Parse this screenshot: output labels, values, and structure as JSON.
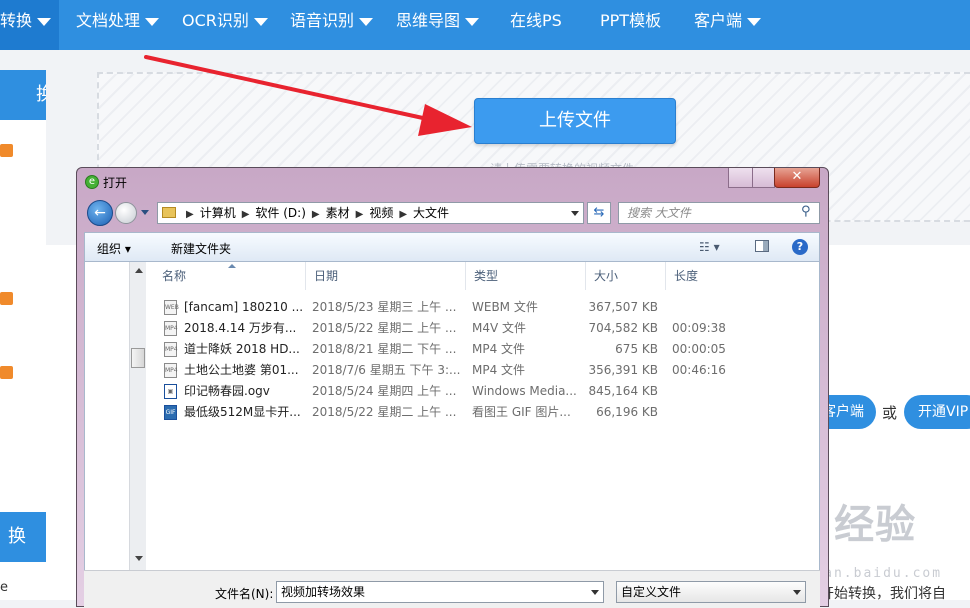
{
  "topnav": {
    "items": [
      {
        "label": "转换"
      },
      {
        "label": "文档处理"
      },
      {
        "label": "OCR识别"
      },
      {
        "label": "语音识别"
      },
      {
        "label": "思维导图"
      },
      {
        "label": "在线PS"
      },
      {
        "label": "PPT模板"
      },
      {
        "label": "客户端"
      }
    ]
  },
  "sidebar": {
    "head1": "换",
    "head2": "换",
    "bottom_text": "e"
  },
  "upload": {
    "button_label": "上传文件",
    "hint": "请上传需要转换的视频文件"
  },
  "promo": {
    "client_label": "客户端",
    "or": "或",
    "vip_label": "开通VIP",
    "bottom_text": "开始转换，我们将自"
  },
  "watermark": {
    "main": "Bai 经验",
    "sub": "jingyan.baidu.com"
  },
  "dialog": {
    "title": "打开",
    "close_label": "✕",
    "address": {
      "segments": [
        "计算机",
        "软件 (D:)",
        "素材",
        "视频",
        "大文件"
      ]
    },
    "search_placeholder": "搜索 大文件",
    "toolbar": {
      "organize": "组织 ▾",
      "new_folder": "新建文件夹"
    },
    "columns": {
      "name": "名称",
      "date": "日期",
      "type": "类型",
      "size": "大小",
      "length": "长度"
    },
    "files": [
      {
        "icon": "WEB",
        "name": "[fancam] 180210 ...",
        "date": "2018/5/23 星期三 上午 ...",
        "type": "WEBM 文件",
        "size": "367,507 KB",
        "length": ""
      },
      {
        "icon": "MP4",
        "name": "2018.4.14 万步有...",
        "date": "2018/5/22 星期二 上午 ...",
        "type": "M4V 文件",
        "size": "704,582 KB",
        "length": "00:09:38"
      },
      {
        "icon": "MP4",
        "name": "道士降妖 2018 HD...",
        "date": "2018/8/21 星期二 下午 ...",
        "type": "MP4 文件",
        "size": "675 KB",
        "length": "00:00:05"
      },
      {
        "icon": "MP4",
        "name": "土地公土地婆 第01...",
        "date": "2018/7/6 星期五 下午 3:...",
        "type": "MP4 文件",
        "size": "356,391 KB",
        "length": "00:46:16"
      },
      {
        "icon": "▣",
        "name": "印记畅春园.ogv",
        "date": "2018/5/24 星期四 上午 ...",
        "type": "Windows Media...",
        "size": "845,164 KB",
        "length": ""
      },
      {
        "icon": "GIF",
        "name": "最低级512M显卡开...",
        "date": "2018/5/22 星期二 上午 ...",
        "type": "看图王 GIF 图片...",
        "size": "66,196 KB",
        "length": ""
      }
    ],
    "filename_label": "文件名(N):",
    "filename_value": "视频加转场效果",
    "filetype_value": "自定义文件"
  },
  "colors": {
    "nav_blue": "#2f8fe0",
    "button_blue": "#3c9bef",
    "arrow_red": "#e8232f",
    "dialog_frame": "#d8bcd8"
  }
}
